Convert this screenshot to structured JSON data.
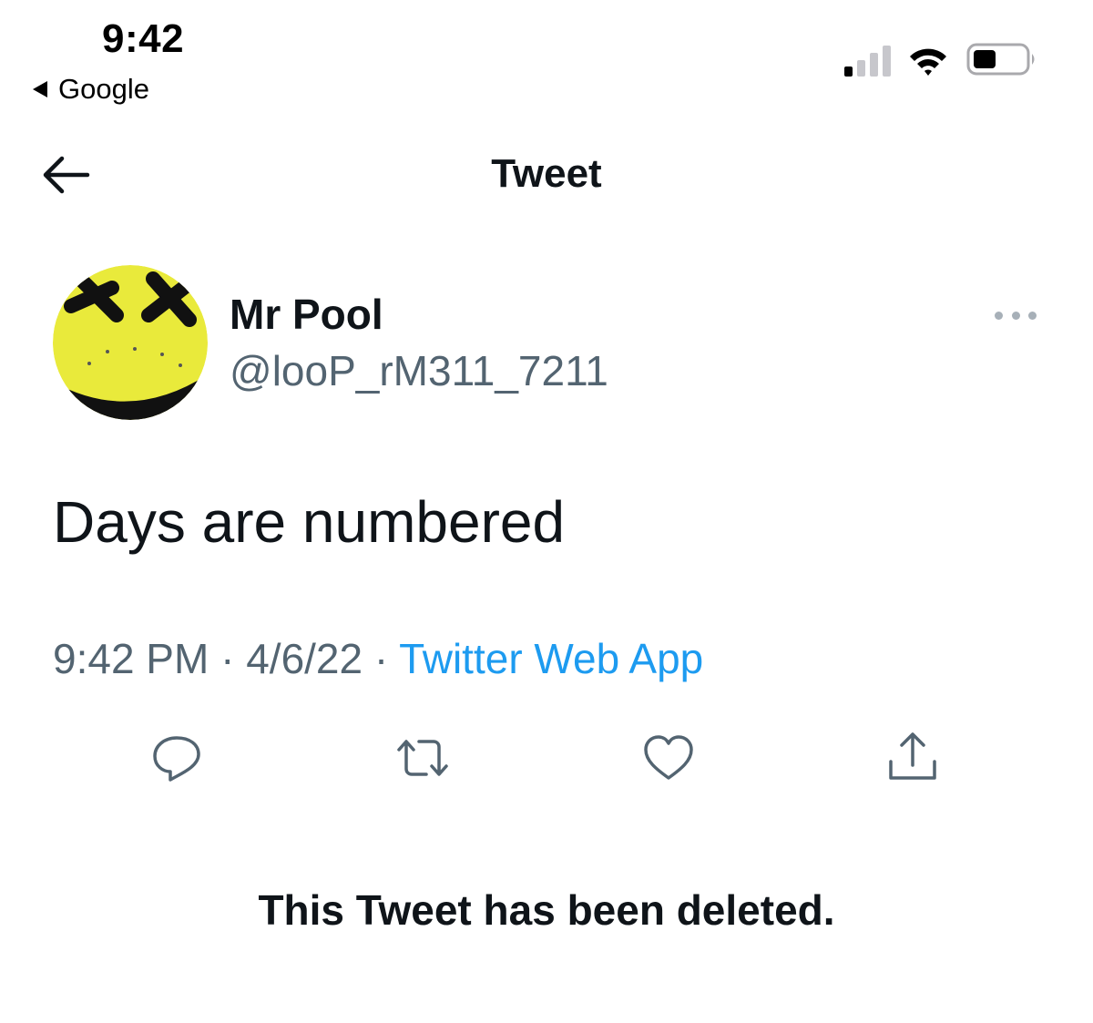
{
  "status_bar": {
    "time": "9:42",
    "back_app": "Google"
  },
  "header": {
    "title": "Tweet"
  },
  "tweet": {
    "author_name": "Mr Pool",
    "author_handle": "@looP_rM311_7211",
    "text": "Days are numbered",
    "time": "9:42 PM",
    "date": "4/6/22",
    "separator": "·",
    "source": "Twitter Web App",
    "deleted_notice": "This Tweet has been deleted."
  },
  "colors": {
    "link_blue": "#1d9bf0",
    "secondary_text": "#536471",
    "avatar_yellow": "#e9ea3b"
  },
  "icons": {
    "back": "arrow-left-icon",
    "more": "more-horizontal-icon",
    "reply": "reply-icon",
    "retweet": "retweet-icon",
    "like": "heart-icon",
    "share": "share-icon"
  }
}
